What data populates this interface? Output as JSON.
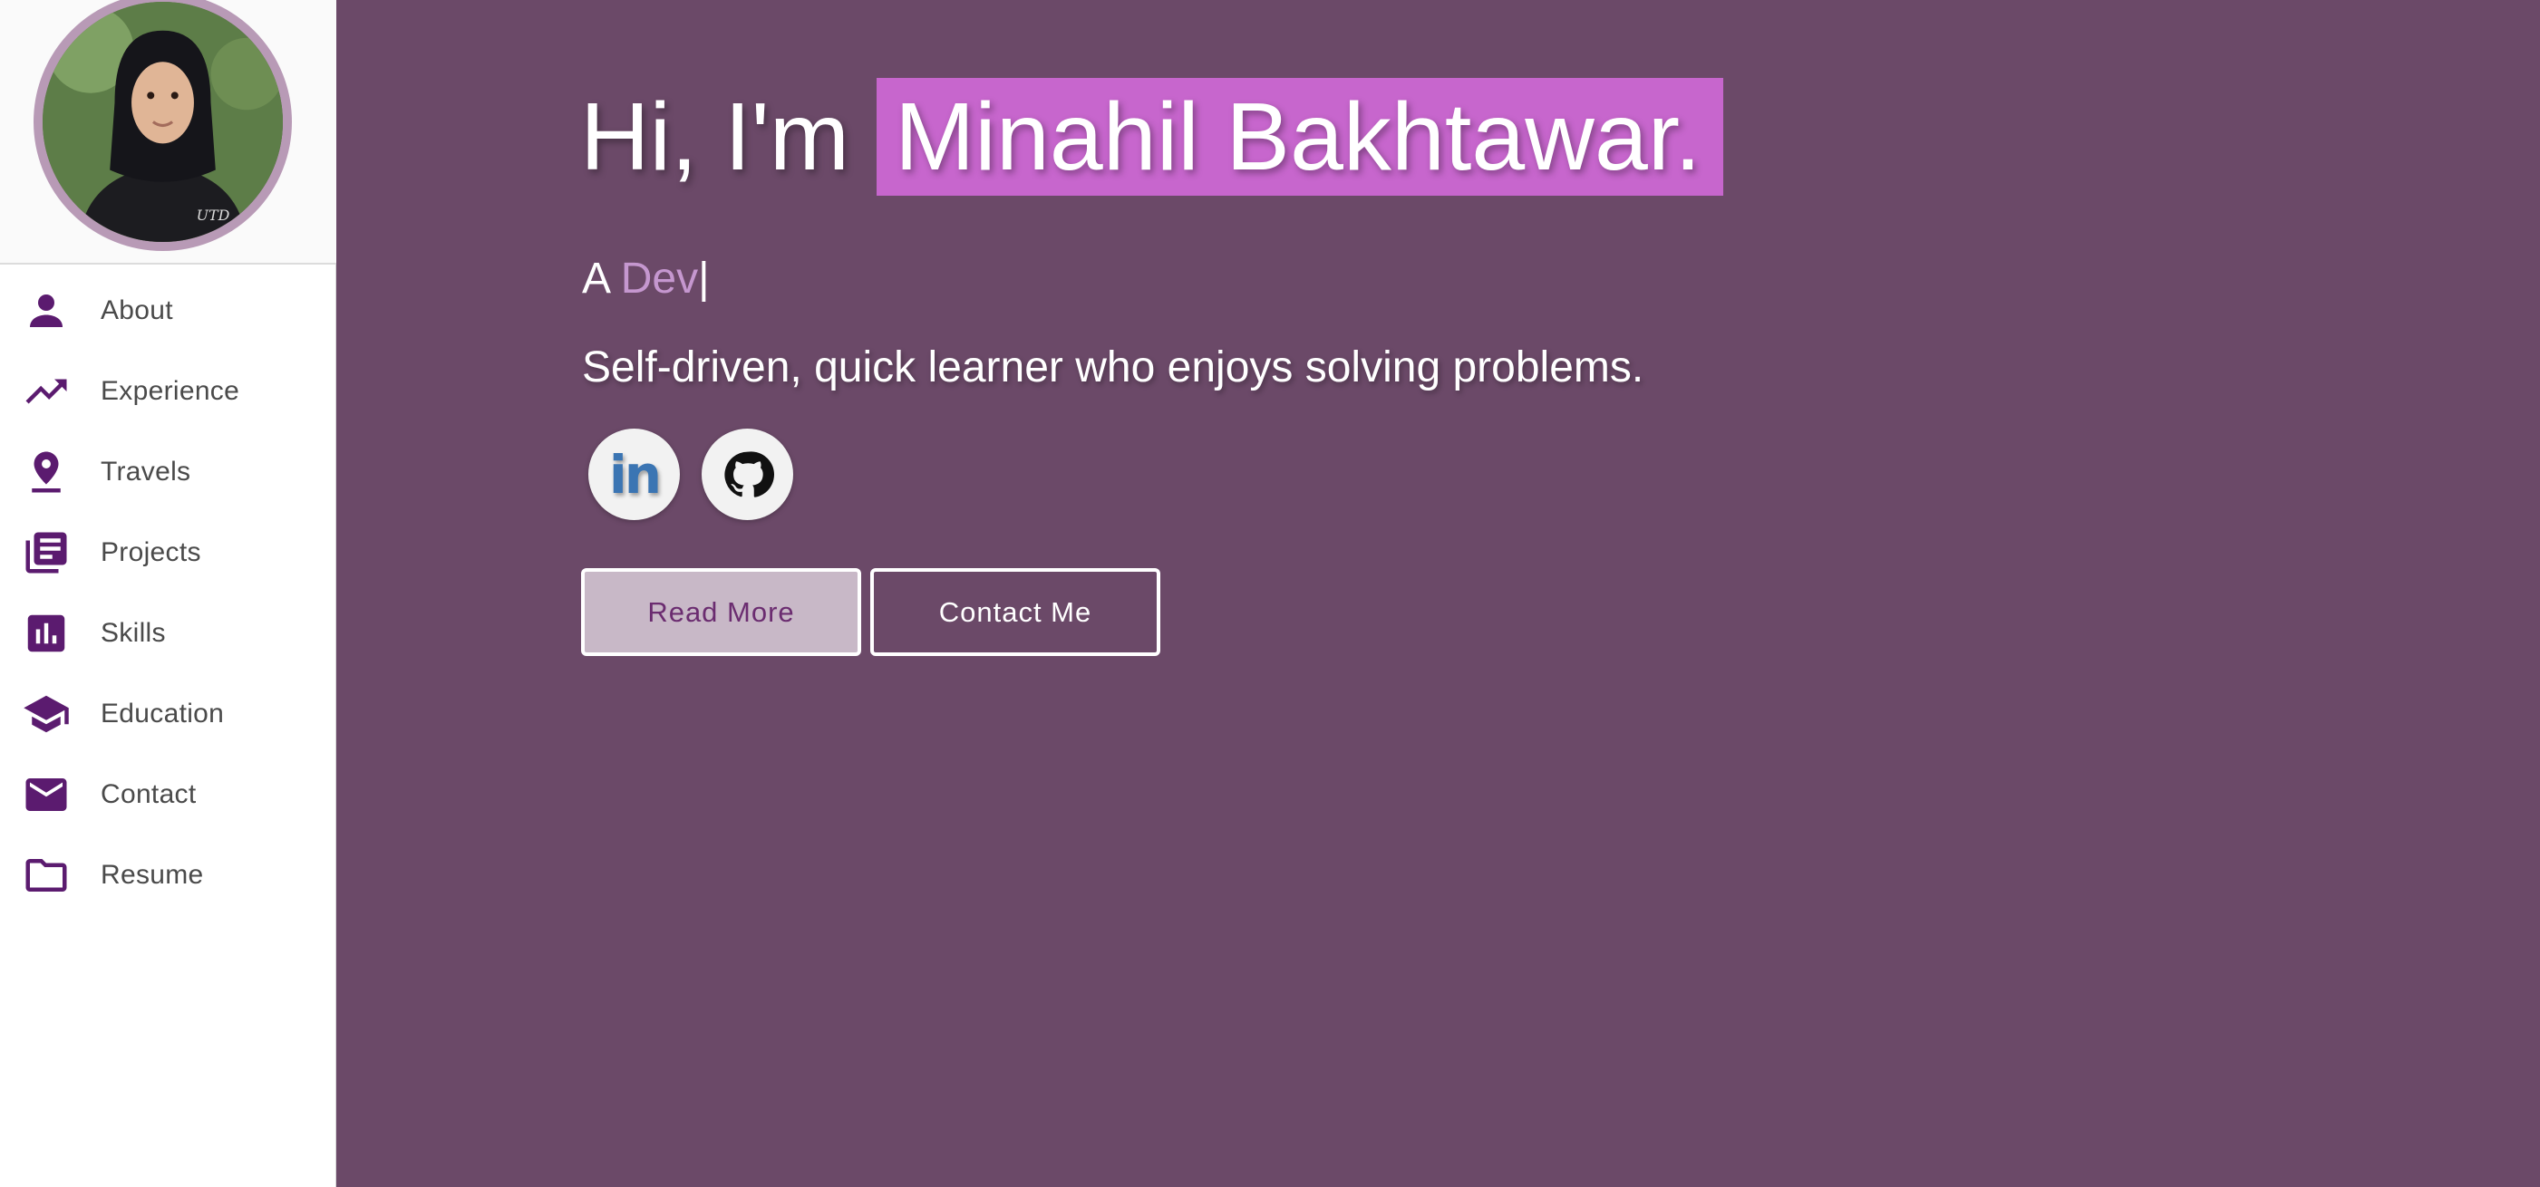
{
  "sidebar": {
    "items": [
      {
        "label": "About",
        "icon": "person-icon"
      },
      {
        "label": "Experience",
        "icon": "trending-up-icon"
      },
      {
        "label": "Travels",
        "icon": "location-pin-icon"
      },
      {
        "label": "Projects",
        "icon": "library-books-icon"
      },
      {
        "label": "Skills",
        "icon": "bar-chart-icon"
      },
      {
        "label": "Education",
        "icon": "graduation-cap-icon"
      },
      {
        "label": "Contact",
        "icon": "mail-icon"
      },
      {
        "label": "Resume",
        "icon": "folder-icon"
      }
    ]
  },
  "hero": {
    "greeting": "Hi, I'm",
    "name": "Minahil Bakhtawar.",
    "subtitle_prefix": "A",
    "subtitle_role": "Dev",
    "subtitle_cursor": "|",
    "tagline": "Self-driven, quick learner who enjoys solving problems.",
    "social": [
      {
        "name": "LinkedIn",
        "icon": "linkedin-icon",
        "glyph": "in"
      },
      {
        "name": "GitHub",
        "icon": "github-icon"
      }
    ],
    "buttons": {
      "read_more": "Read More",
      "contact": "Contact Me"
    }
  },
  "colors": {
    "main_bg": "#6b4968",
    "name_highlight": "#c766cd",
    "icon_purple": "#5b1b6f",
    "role_text": "#c597cf"
  }
}
